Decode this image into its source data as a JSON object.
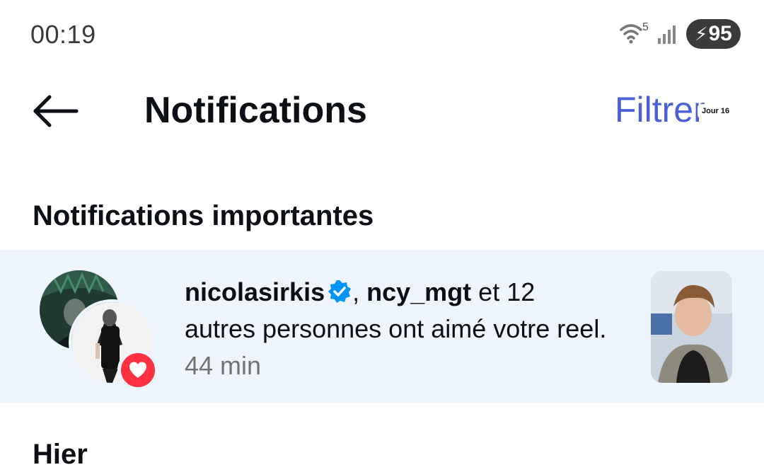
{
  "status_bar": {
    "time": "00:19",
    "wifi_icon": "wifi-icon",
    "wifi_badge": "5",
    "signal_icon": "signal-icon",
    "battery_icon": "battery-charging-icon",
    "battery_level": "95"
  },
  "header": {
    "title": "Notifications",
    "filter_label": "Filtrer",
    "back_icon": "arrow-left-icon"
  },
  "sections": {
    "important_title": "Notifications importantes",
    "yesterday_title": "Hier"
  },
  "notification": {
    "user1": "nicolasirkis",
    "separator": ", ",
    "user2": "ncy_mgt",
    "and_count": " et 12",
    "text": "autres personnes ont aimé votre reel.",
    "time": "44 min",
    "thumbnail_label": "Jour 16",
    "badge_icon": "heart-icon",
    "verified_icon": "verified-badge-icon"
  },
  "colors": {
    "accent": "#4a5fd8",
    "highlight_bg": "#eff5fc",
    "like_red": "#ff3040",
    "verified_blue": "#0095f6"
  }
}
